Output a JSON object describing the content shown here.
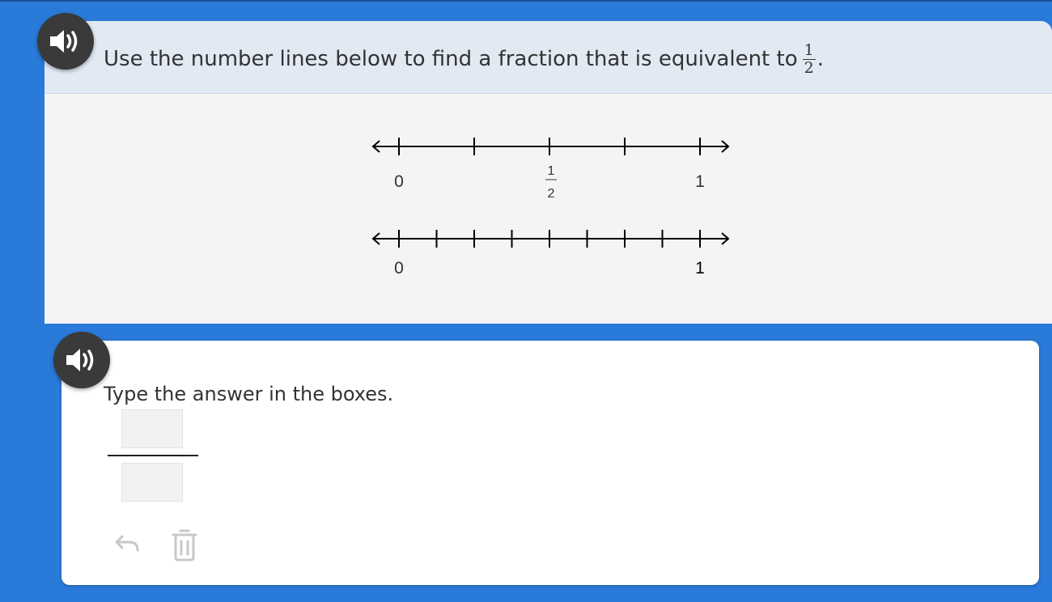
{
  "question": {
    "prompt_text": "Use the number lines below to find a fraction that is equivalent to",
    "prompt_fraction": {
      "numerator": "1",
      "denominator": "2"
    },
    "prompt_end": "."
  },
  "number_line_top": {
    "divisions": 4,
    "labels": {
      "start": "0",
      "half_numerator": "1",
      "half_denominator": "2",
      "end": "1"
    }
  },
  "number_line_bottom": {
    "divisions": 8,
    "labels": {
      "start": "0",
      "end": "1"
    }
  },
  "answer": {
    "instruction": "Type the answer in the boxes.",
    "numerator_value": "",
    "denominator_value": ""
  },
  "icons": {
    "audio": "speaker-icon",
    "undo": "undo-icon",
    "delete": "trash-icon"
  },
  "colors": {
    "background": "#2a7ad9",
    "header": "#e1e9f3",
    "panel": "#f4f4f4",
    "audio_button": "#3a3a3a",
    "disabled_icon": "#c8c8c8"
  }
}
